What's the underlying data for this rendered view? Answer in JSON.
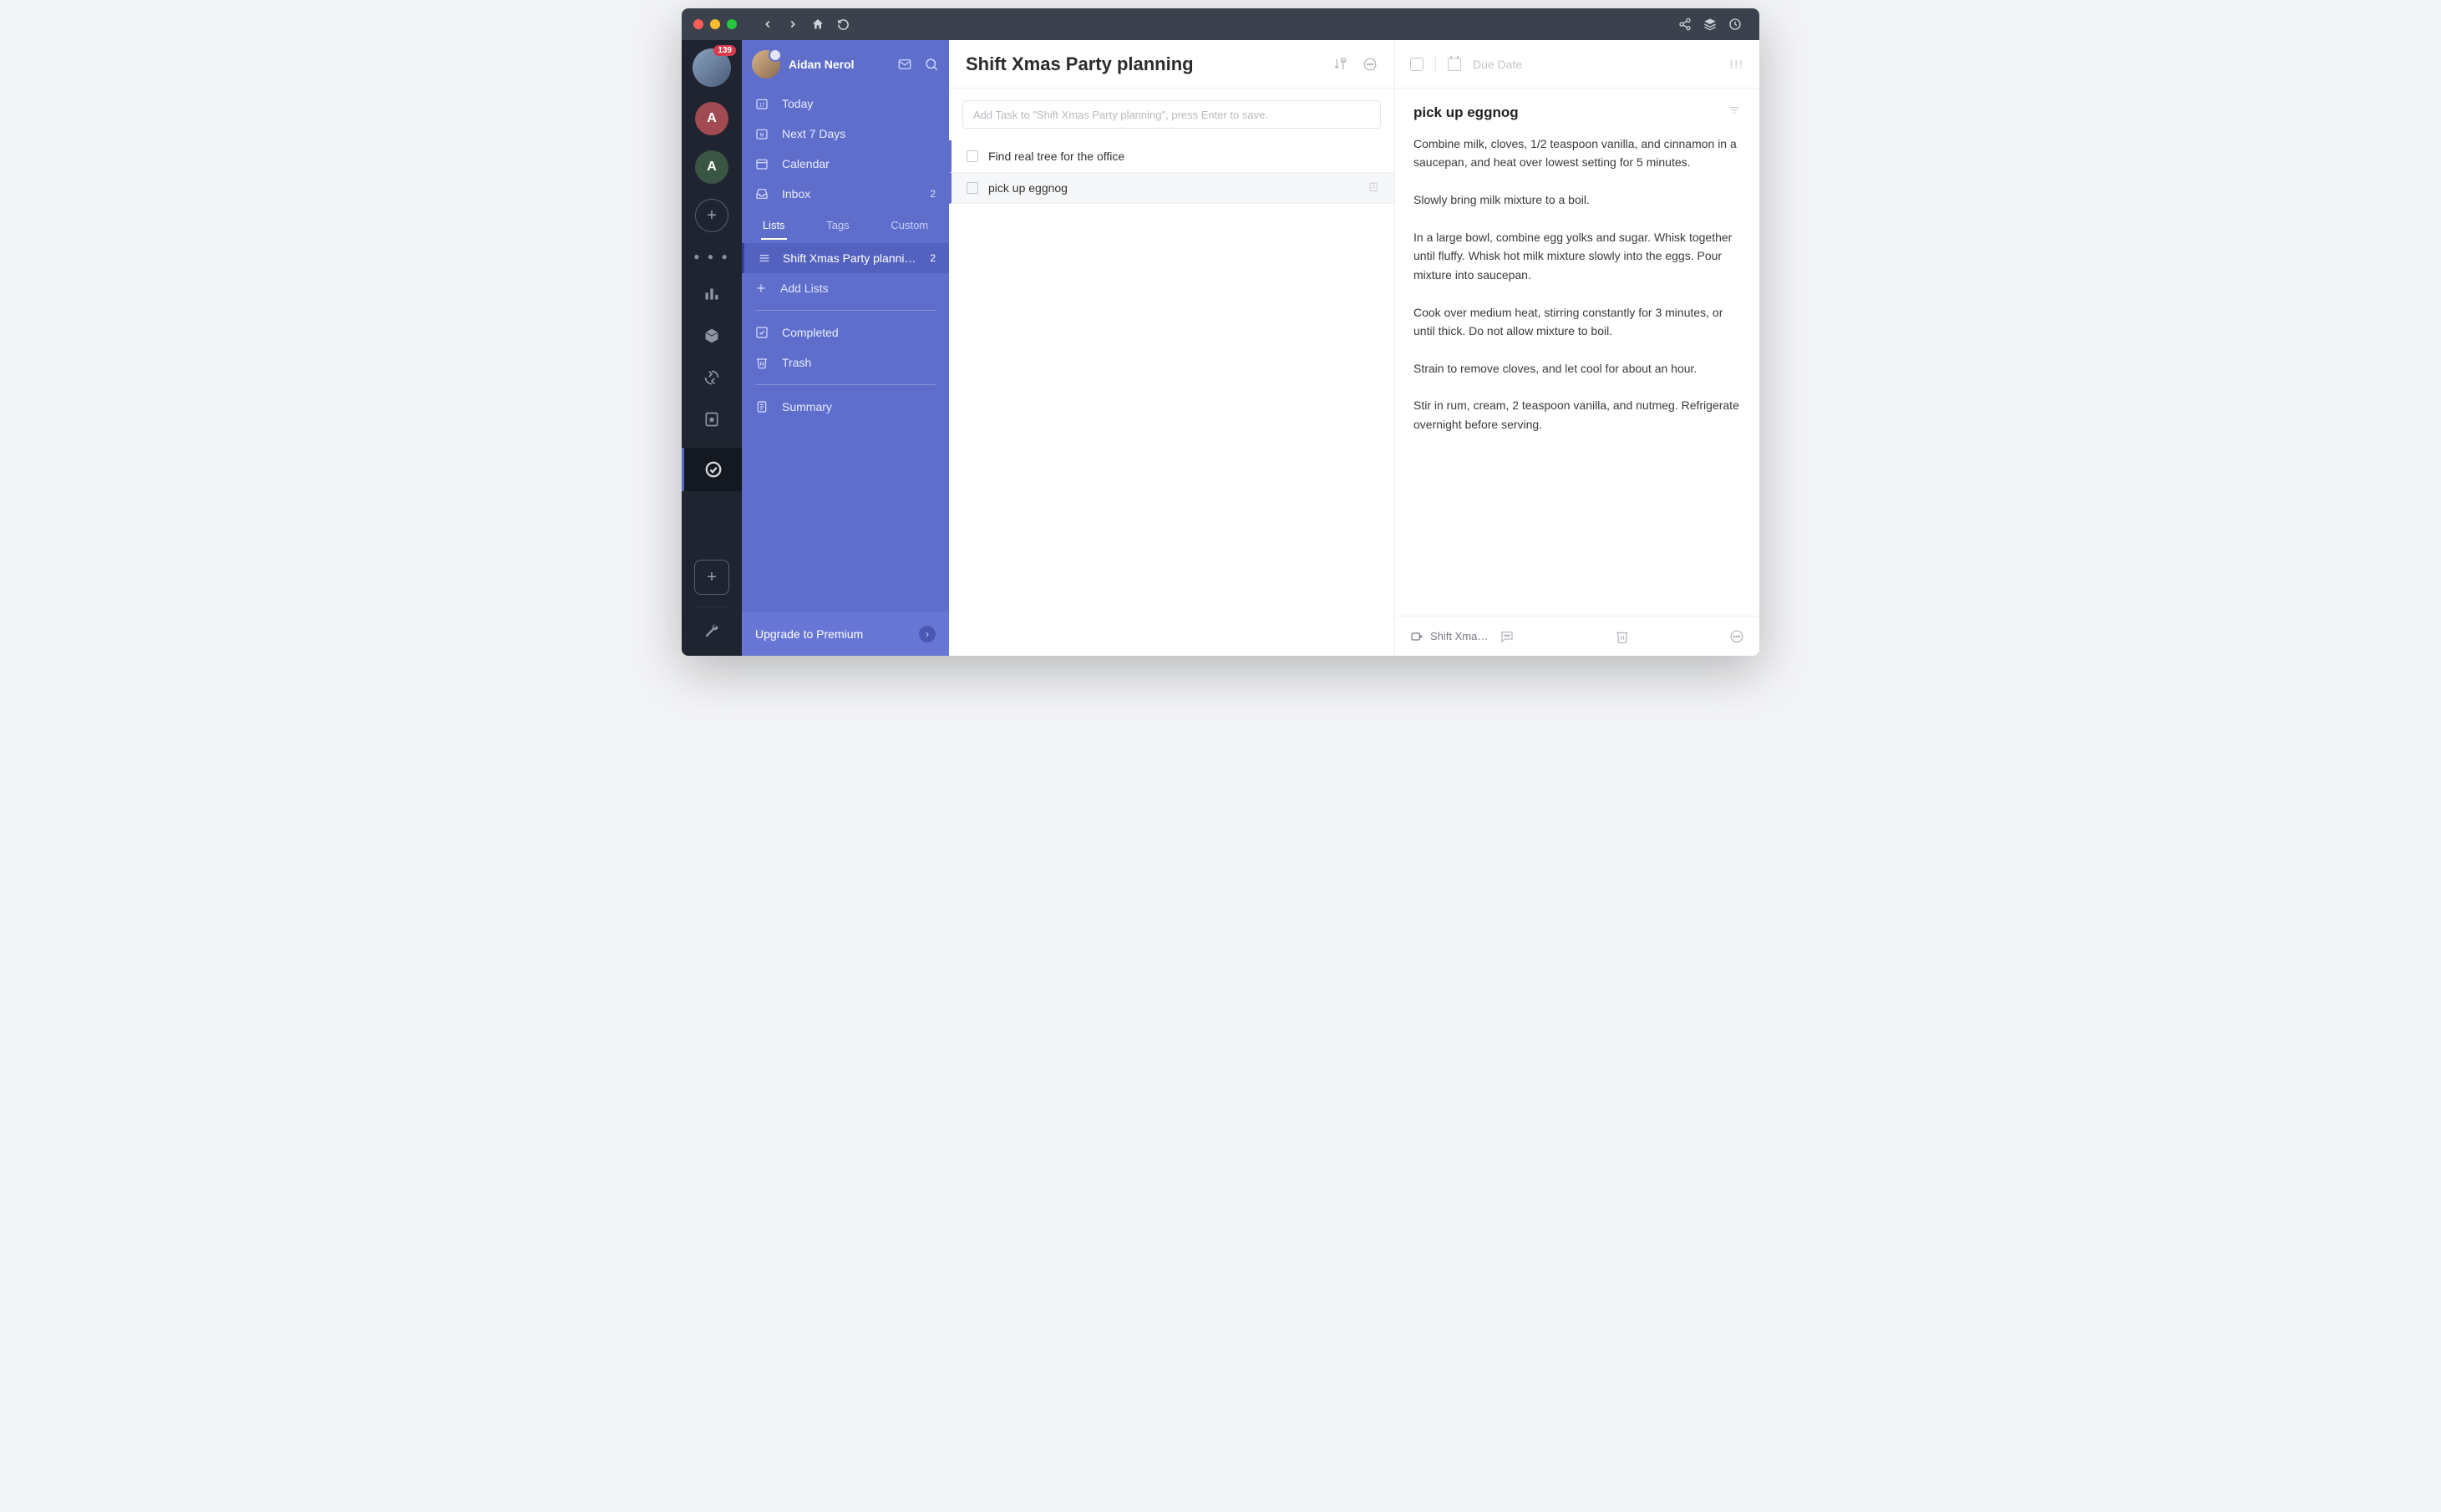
{
  "rail": {
    "badge": "139",
    "workspaces": [
      {
        "letter": "A",
        "class": "red"
      },
      {
        "letter": "A",
        "class": "green"
      }
    ]
  },
  "sidebar": {
    "user_name": "Aidan Nerol",
    "nav": {
      "today": "Today",
      "next7": "Next 7 Days",
      "calendar": "Calendar",
      "inbox": "Inbox",
      "inbox_count": "2"
    },
    "tabs": {
      "lists": "Lists",
      "tags": "Tags",
      "custom": "Custom"
    },
    "lists": [
      {
        "name": "Shift Xmas Party planni…",
        "count": "2"
      }
    ],
    "add_lists": "Add Lists",
    "completed": "Completed",
    "trash": "Trash",
    "summary": "Summary",
    "upgrade": "Upgrade to Premium"
  },
  "tasklist": {
    "title": "Shift Xmas Party planning",
    "add_placeholder": "Add Task to \"Shift Xmas Party planning\", press Enter to save.",
    "tasks": [
      {
        "title": "Find real tree for the office",
        "selected": false
      },
      {
        "title": "pick up eggnog",
        "selected": true
      }
    ]
  },
  "detail": {
    "due_label": "Due Date",
    "title": "pick up eggnog",
    "description": "Combine milk, cloves, 1/2 teaspoon vanilla, and cinnamon in a saucepan, and heat over lowest setting for 5 minutes.\n\nSlowly bring milk mixture to a boil.\n\nIn a large bowl, combine egg yolks and sugar. Whisk together until fluffy. Whisk hot milk mixture slowly into the eggs. Pour mixture into saucepan.\n\nCook over medium heat, stirring constantly for 3 minutes, or until thick. Do not allow mixture to boil.\n\nStrain to remove cloves, and let cool for about an hour.\n\nStir in rum, cream, 2 teaspoon vanilla, and nutmeg. Refrigerate overnight before serving.",
    "footer_project": "Shift Xma…"
  }
}
